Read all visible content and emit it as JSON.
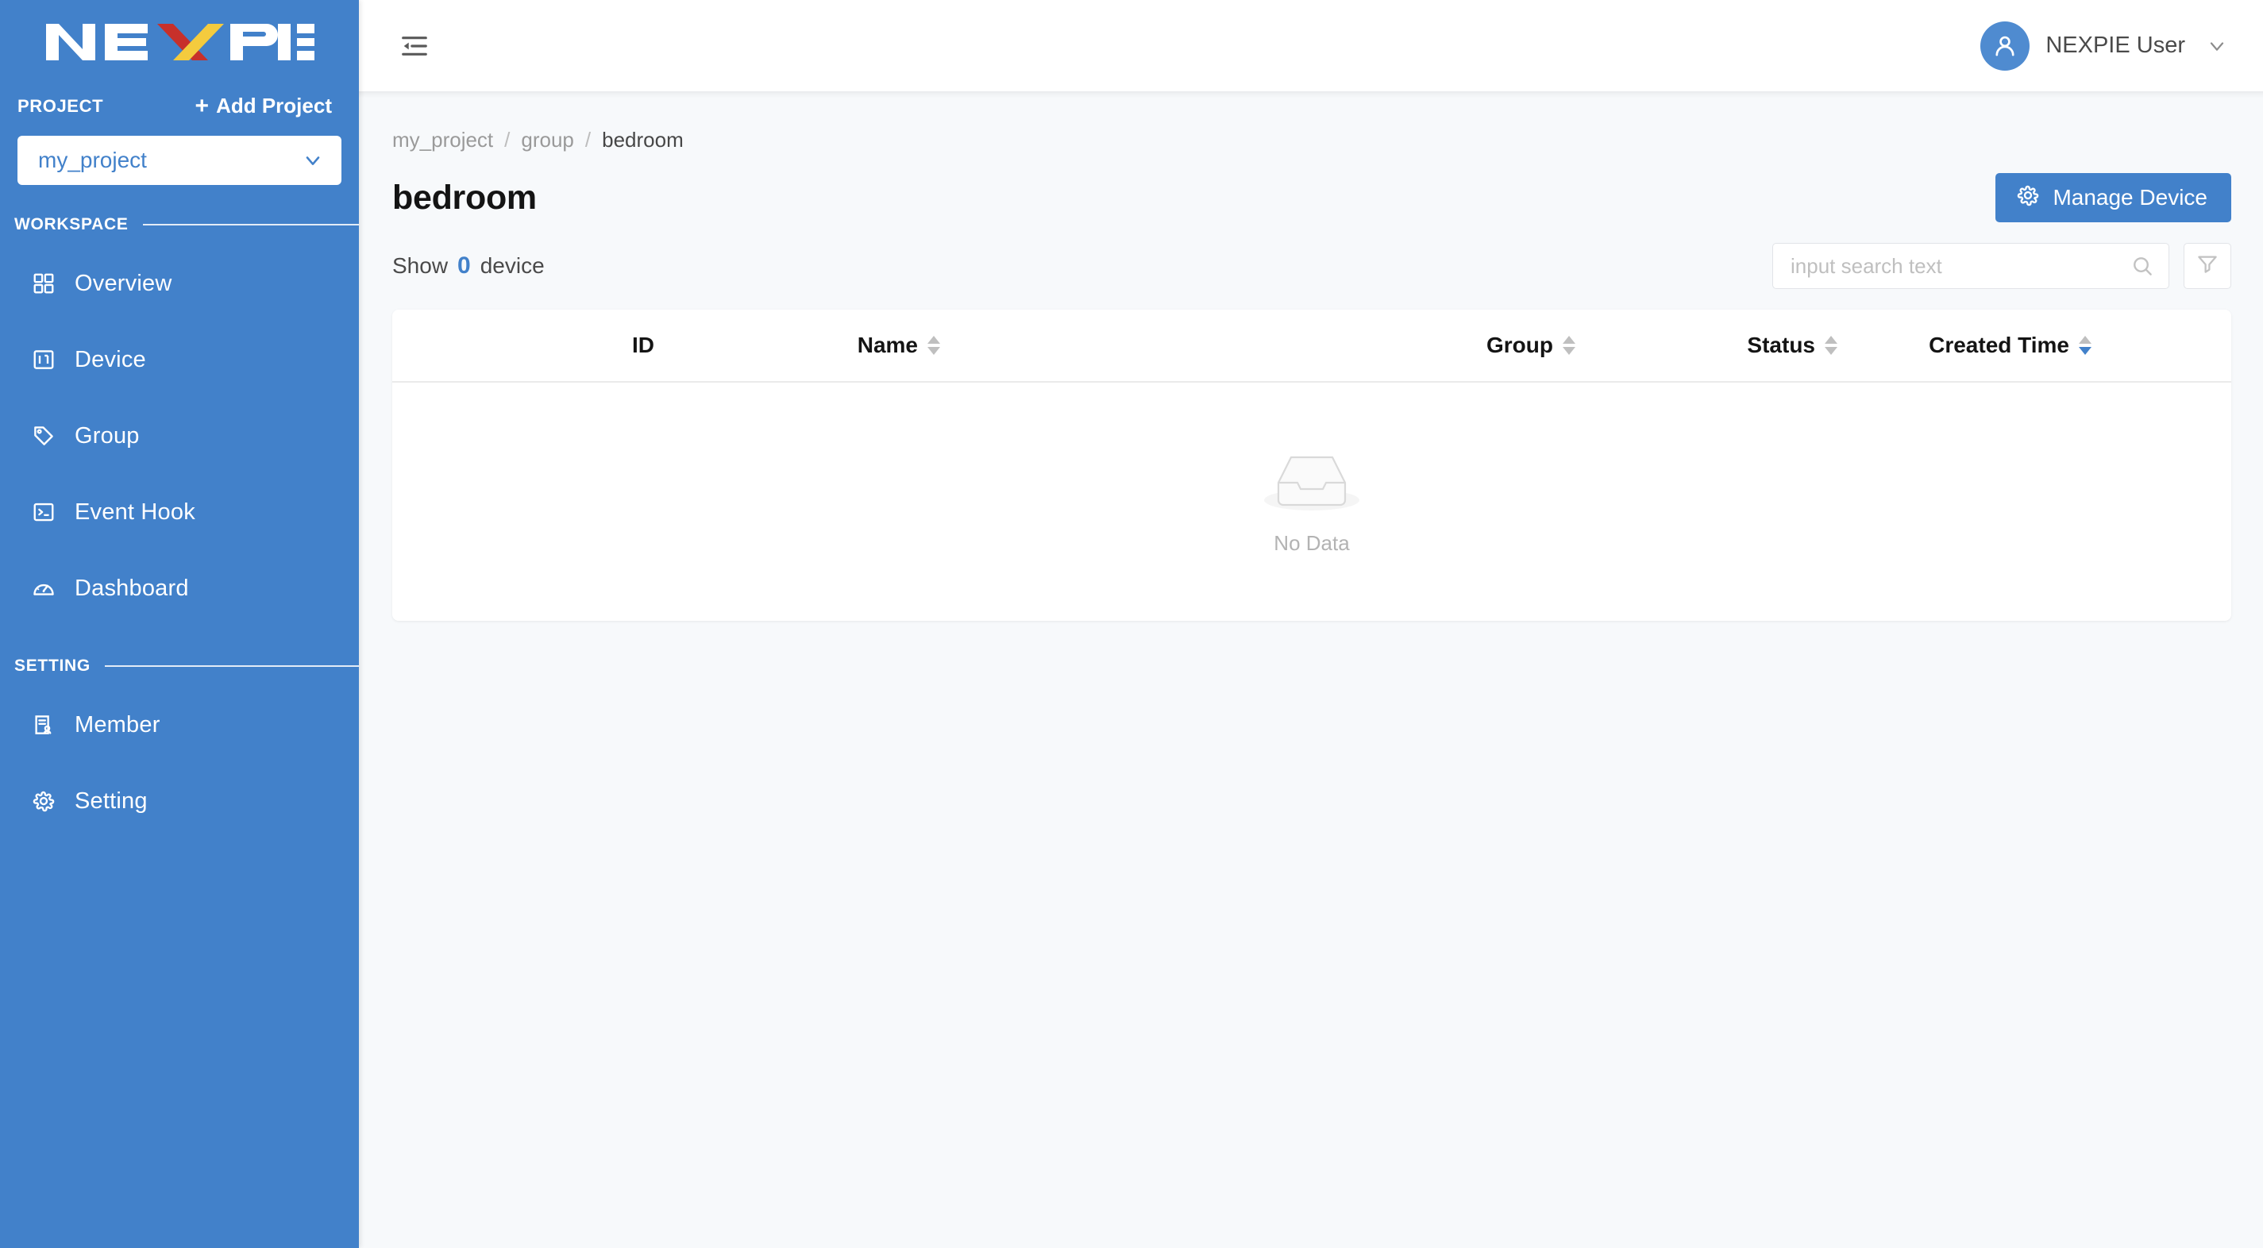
{
  "brand": {
    "name": "NEXPIE",
    "logo_text_color": "#FFFFFF",
    "logo_x_left_color": "#C7302B",
    "logo_x_right_color": "#F4CB3E"
  },
  "theme": {
    "sidebar_bg": "#4281CA",
    "accent": "#4281CA",
    "content_bg": "#F7F9FB",
    "card_bg": "#FFFFFF"
  },
  "sidebar": {
    "project_label": "PROJECT",
    "add_project_label": "Add Project",
    "add_project_plus": "+",
    "project_select": {
      "value": "my_project",
      "icon": "chevron-down-icon"
    },
    "sections": [
      {
        "title": "WORKSPACE",
        "items": [
          {
            "label": "Overview",
            "icon": "grid-icon"
          },
          {
            "label": "Device",
            "icon": "device-panel-icon"
          },
          {
            "label": "Group",
            "icon": "tag-icon"
          },
          {
            "label": "Event Hook",
            "icon": "console-icon"
          },
          {
            "label": "Dashboard",
            "icon": "gauge-icon"
          }
        ]
      },
      {
        "title": "SETTING",
        "items": [
          {
            "label": "Member",
            "icon": "member-doc-icon"
          },
          {
            "label": "Setting",
            "icon": "gear-icon"
          }
        ]
      }
    ]
  },
  "topbar": {
    "collapse_icon": "menu-fold-icon",
    "user_name": "NEXPIE User",
    "avatar_icon": "user-icon",
    "user_chevron_icon": "chevron-down-icon"
  },
  "breadcrumb": {
    "items": [
      {
        "label": "my_project",
        "current": false
      },
      {
        "label": "group",
        "current": false
      },
      {
        "label": "bedroom",
        "current": true
      }
    ],
    "separator": "/"
  },
  "page": {
    "title": "bedroom",
    "manage_button": {
      "label": "Manage Device",
      "icon": "gear-icon"
    }
  },
  "toolbar": {
    "show_prefix": "Show",
    "count": "0",
    "show_suffix": "device",
    "search": {
      "placeholder": "input search text",
      "value": "",
      "icon": "search-icon"
    },
    "filter_button": {
      "icon": "filter-funnel-icon"
    }
  },
  "table": {
    "columns": [
      {
        "label": "ID",
        "sortable": false,
        "sort": "none"
      },
      {
        "label": "Name",
        "sortable": true,
        "sort": "none"
      },
      {
        "label": "Group",
        "sortable": true,
        "sort": "none"
      },
      {
        "label": "Status",
        "sortable": true,
        "sort": "none"
      },
      {
        "label": "Created Time",
        "sortable": true,
        "sort": "desc"
      }
    ],
    "rows": [],
    "empty": {
      "text": "No Data",
      "icon": "empty-box-icon"
    }
  }
}
